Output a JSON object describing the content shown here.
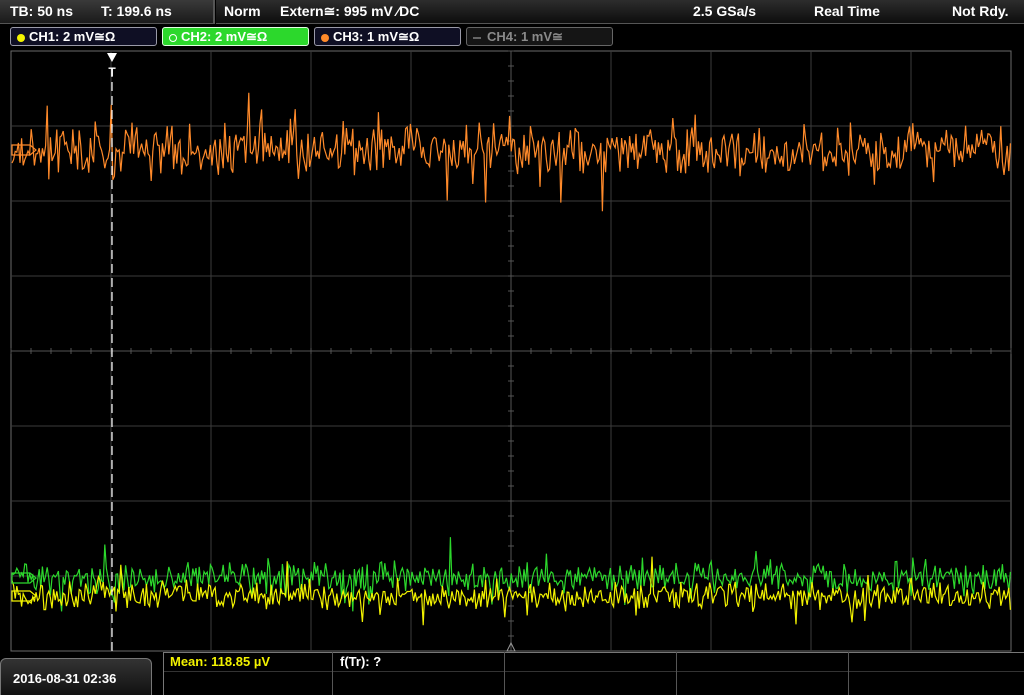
{
  "topbar": {
    "timebase": "TB: 50 ns",
    "trigger_time": "T: 199.6 ns",
    "mode": "Norm",
    "trigger_source": "Extern≅: 995 mV ∕DC",
    "sample_rate": "2.5 GSa/s",
    "acq_mode": "Real Time",
    "status": "Not Rdy."
  },
  "channels": [
    {
      "label": "CH1: 2 mV≅Ω",
      "color": "#f2f200",
      "state": "on"
    },
    {
      "label": "CH2: 2 mV≅Ω",
      "color": "#2cd82c",
      "state": "selected"
    },
    {
      "label": "CH3: 1 mV≅Ω",
      "color": "#ff8a2a",
      "state": "on"
    },
    {
      "label": "CH4: 1 mV≅",
      "color": "#8a8a8a",
      "state": "off"
    }
  ],
  "trigger_marker": "T",
  "measurements": {
    "mean": "Mean: 118.85 µV",
    "freq": "f(Tr): ?"
  },
  "datetime": "2016-08-31 02:36",
  "colors": {
    "ch1": "#f2f200",
    "ch2": "#2cd82c",
    "ch3": "#ff8a2a",
    "grid": "#3c3c3c"
  }
}
